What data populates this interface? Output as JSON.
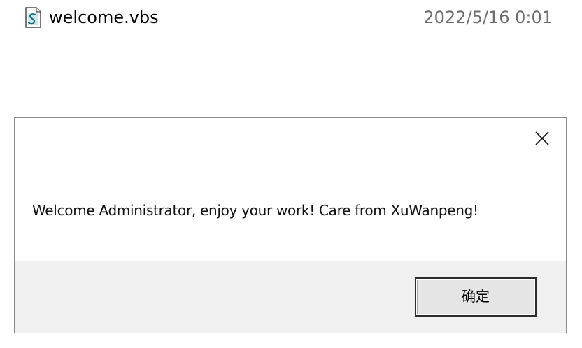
{
  "file": {
    "icon": "vbscript-file-icon",
    "name": "welcome.vbs",
    "modified": "2022/5/16 0:01"
  },
  "dialog": {
    "close_icon": "close-icon",
    "message": "Welcome Administrator, enjoy your work! Care from XuWanpeng!",
    "ok_label": "确定"
  },
  "colors": {
    "dialog_border": "#8a8a8a",
    "footer_bg": "#f0f0f0",
    "date_text": "#6d6d6d",
    "button_border": "#2b2b2b"
  }
}
